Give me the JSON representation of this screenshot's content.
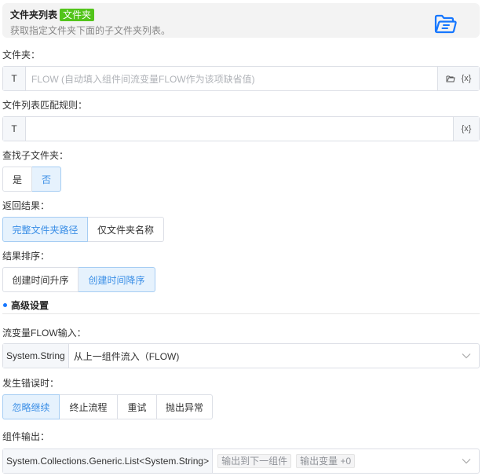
{
  "header": {
    "title": "文件夹列表",
    "tag": "文件夹",
    "description": "获取指定文件夹下面的子文件夹列表。",
    "icon": "folder-open-icon"
  },
  "folder": {
    "label": "文件夹：",
    "prefix": "T",
    "placeholder": "FLOW (自动填入组件间流变量FLOW作为该项缺省值)",
    "variable_button": "{x}"
  },
  "pattern": {
    "label": "文件列表匹配规则：",
    "prefix": "T",
    "value": "",
    "variable_button": "{x}"
  },
  "subfolders": {
    "label": "查找子文件夹：",
    "options": [
      "是",
      "否"
    ],
    "selected": "否"
  },
  "result": {
    "label": "返回结果：",
    "options": [
      "完整文件夹路径",
      "仅文件夹名称"
    ],
    "selected": "完整文件夹路径"
  },
  "sort": {
    "label": "结果排序：",
    "options": [
      "创建时间升序",
      "创建时间降序"
    ],
    "selected": "创建时间降序"
  },
  "advanced": {
    "title": "高级设置"
  },
  "flow_input": {
    "label": "流变量FLOW输入：",
    "type": "System.String",
    "value": "从上一组件流入（FLOW)"
  },
  "on_error": {
    "label": "发生错误时：",
    "options": [
      "忽略继续",
      "终止流程",
      "重试",
      "抛出异常"
    ],
    "selected": "忽略继续"
  },
  "output": {
    "label": "组件输出：",
    "type": "System.Collections.Generic.List<System.String>",
    "chips": [
      "输出到下一组件",
      "输出变量 +0"
    ]
  },
  "colors": {
    "accent": "#3a8ee6",
    "tag_green": "#52c41a",
    "icon_blue": "#1677ff"
  }
}
